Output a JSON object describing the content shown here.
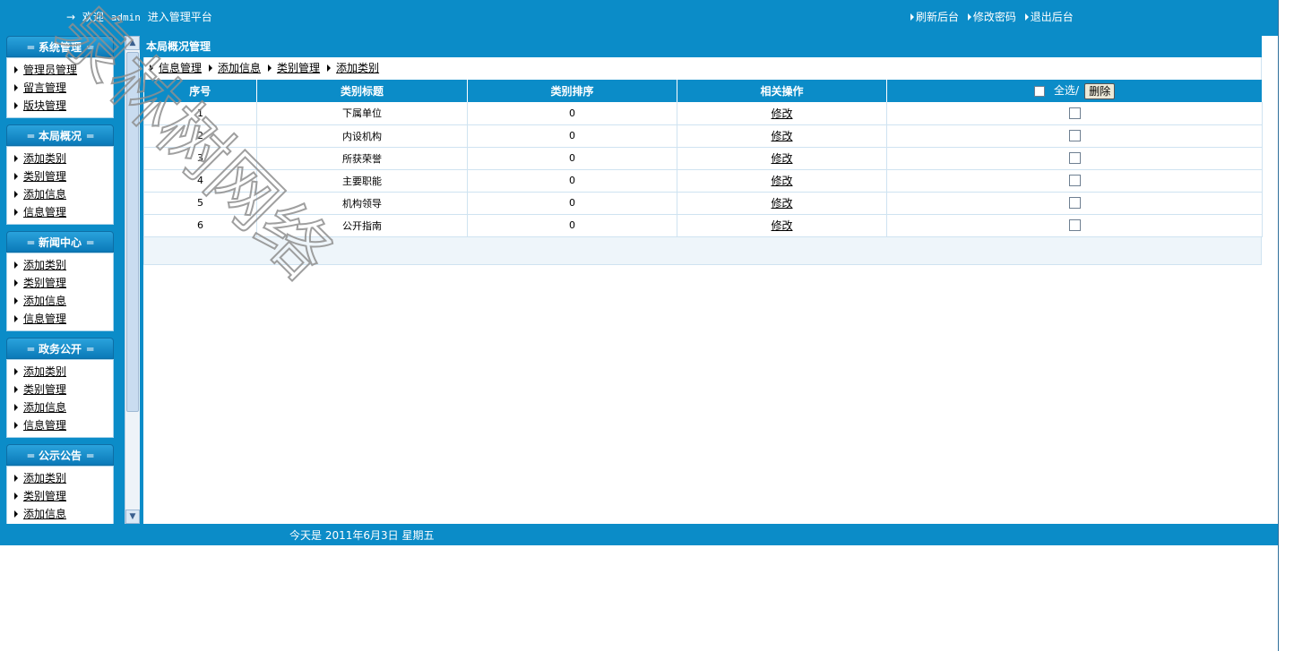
{
  "header": {
    "arrow": "→",
    "welcome_prefix": "欢迎",
    "username": "admin",
    "welcome_suffix": "进入管理平台",
    "links": [
      "刷新后台",
      "修改密码",
      "退出后台"
    ]
  },
  "sidebar": [
    {
      "title": "系统管理",
      "items": [
        "管理员管理",
        "留言管理",
        "版块管理"
      ]
    },
    {
      "title": "本局概况",
      "items": [
        "添加类别",
        "类别管理",
        "添加信息",
        "信息管理"
      ]
    },
    {
      "title": "新闻中心",
      "items": [
        "添加类别",
        "类别管理",
        "添加信息",
        "信息管理"
      ]
    },
    {
      "title": "政务公开",
      "items": [
        "添加类别",
        "类别管理",
        "添加信息",
        "信息管理"
      ]
    },
    {
      "title": "公示公告",
      "items": [
        "添加类别",
        "类别管理",
        "添加信息"
      ]
    }
  ],
  "main": {
    "title": "本局概况管理",
    "breadcrumbs": [
      "信息管理",
      "添加信息",
      "类别管理",
      "添加类别"
    ],
    "table": {
      "columns": [
        "序号",
        "类别标题",
        "类别排序",
        "相关操作"
      ],
      "select_all_label": "全选/",
      "delete_label": "删除",
      "rows": [
        {
          "id": "1",
          "title": "下属单位",
          "order": "0",
          "action": "修改"
        },
        {
          "id": "2",
          "title": "内设机构",
          "order": "0",
          "action": "修改"
        },
        {
          "id": "3",
          "title": "所获荣誉",
          "order": "0",
          "action": "修改"
        },
        {
          "id": "4",
          "title": "主要职能",
          "order": "0",
          "action": "修改"
        },
        {
          "id": "5",
          "title": "机构领导",
          "order": "0",
          "action": "修改"
        },
        {
          "id": "6",
          "title": "公开指南",
          "order": "0",
          "action": "修改"
        }
      ]
    }
  },
  "footer": {
    "today_label": "今天是",
    "date": "2011年6月3日",
    "weekday": "星期五"
  },
  "watermark": "泉林树网络",
  "colors": {
    "primary": "#0b8cc8",
    "border": "#cfe3f1"
  },
  "icons": {
    "menu_bullet": "triangle-right-icon",
    "scroll_up": "scroll-up-arrow-icon",
    "scroll_down": "scroll-down-arrow-icon"
  }
}
